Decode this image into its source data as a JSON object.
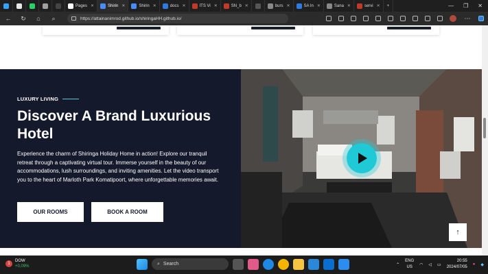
{
  "browser": {
    "tabs": [
      {
        "label": "",
        "color": "#3aa0ff"
      },
      {
        "label": "",
        "color": "#e8e8e8"
      },
      {
        "label": "",
        "color": "#25d366"
      },
      {
        "label": "",
        "color": "#a0a0a0"
      },
      {
        "label": "",
        "color": "#444"
      },
      {
        "label": "Pages",
        "color": "#ffffff"
      },
      {
        "label": "Shirin",
        "color": "#4a8cff",
        "active": true
      },
      {
        "label": "Shirin",
        "color": "#4a8cff"
      },
      {
        "label": "docs",
        "color": "#2d7be0"
      },
      {
        "label": "ITS Vi",
        "color": "#c0392b"
      },
      {
        "label": "SN_b",
        "color": "#c0392b"
      },
      {
        "label": "",
        "color": "#555"
      },
      {
        "label": "burs",
        "color": "#888"
      },
      {
        "label": "SA In",
        "color": "#2d7be0"
      },
      {
        "label": "Sana",
        "color": "#888"
      },
      {
        "label": "servi",
        "color": "#c0392b"
      }
    ],
    "url": "https://attainanimrod.github.io/shiringaHH.github.io/"
  },
  "hero": {
    "eyebrow": "LUXURY LIVING",
    "heading": "Discover A Brand Luxurious Hotel",
    "description": "Experience the charm of Shiringa Holiday Home in action! Explore our tranquil retreat through a captivating virtual tour. Immerse yourself in the beauty of our accommodations, lush surroundings, and inviting amenities. Let the video transport you to the heart of Marloth Park Komatipoort, where unforgettable memories await.",
    "btn_rooms": "OUR ROOMS",
    "btn_book": "BOOK A ROOM",
    "accent": "#1fc9d6",
    "bg": "#141a2b"
  },
  "taskbar": {
    "widget_badge": "1",
    "widget_name": "DOW",
    "widget_change": "+0,09%",
    "search": "Search",
    "lang1": "ENG",
    "lang2": "US",
    "time": "20:55",
    "date": "2024/07/05"
  }
}
